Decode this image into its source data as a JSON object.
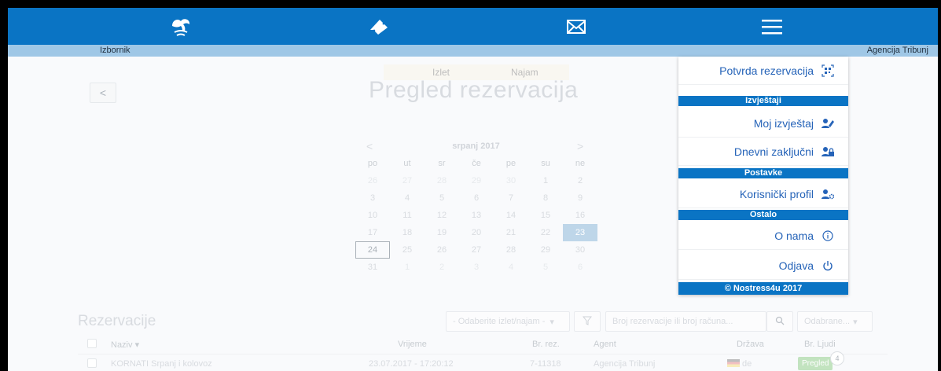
{
  "header": {
    "subbar_left": "Izbornik",
    "subbar_right": "Agencija Tribunj",
    "icons": [
      "island-icon",
      "ticket-icon",
      "mail-icon",
      "hamburger-menu-icon"
    ]
  },
  "main": {
    "tabs": [
      "Izlet",
      "Najam"
    ],
    "title": "Pregled rezervacija",
    "back_glyph": "<"
  },
  "calendar": {
    "month": "srpanj 2017",
    "prev": "<",
    "next": ">",
    "weekdays": [
      "po",
      "ut",
      "sr",
      "če",
      "pe",
      "su",
      "ne"
    ],
    "weeks": [
      [
        "26",
        "27",
        "28",
        "29",
        "30",
        "1",
        "2"
      ],
      [
        "3",
        "4",
        "5",
        "6",
        "7",
        "8",
        "9"
      ],
      [
        "10",
        "11",
        "12",
        "13",
        "14",
        "15",
        "16"
      ],
      [
        "17",
        "18",
        "19",
        "20",
        "21",
        "22",
        "23"
      ],
      [
        "24",
        "25",
        "26",
        "27",
        "28",
        "29",
        "30"
      ],
      [
        "31",
        "1",
        "2",
        "3",
        "4",
        "5",
        "6"
      ]
    ],
    "selected_day": "23",
    "today_day": "24"
  },
  "reservations": {
    "title": "Rezervacije",
    "filter_placeholder": "- Odaberite izlet/najam -",
    "search_placeholder": "Broj rezervacije ili broj računa...",
    "selected_label": "Odabrane...",
    "columns": [
      "Naziv",
      "Vrijeme",
      "Br. rez.",
      "Agent",
      "Država",
      "Br. Ljudi"
    ],
    "rows": [
      {
        "naziv": "KORNATI Srpanj i kolovoz",
        "vrijeme": "23.07.2017 - 17:20:12",
        "br_rez": "7-11318",
        "agent": "Agencija Tribunj",
        "drzava": "de",
        "action": "Pregled",
        "ljudi": "4"
      }
    ]
  },
  "menu": {
    "items": [
      {
        "label": "Potvrda rezervacija",
        "icon": "qr-code-icon"
      },
      {
        "section": "Izvještaji"
      },
      {
        "label": "Moj izvještaj",
        "icon": "user-report-icon"
      },
      {
        "label": "Dnevni zaključni",
        "icon": "user-lock-icon"
      },
      {
        "section": "Postavke"
      },
      {
        "label": "Korisnički profil",
        "icon": "user-settings-icon"
      },
      {
        "section": "Ostalo"
      },
      {
        "label": "O nama",
        "icon": "info-icon"
      },
      {
        "label": "Odjava",
        "icon": "power-icon"
      }
    ],
    "footer": "© Nostress4u 2017"
  },
  "colors": {
    "brand_blue": "#0a74c4",
    "subbar": "#9fc7e6",
    "menu_text": "#2563b8",
    "selected_day": "#9cc1dd"
  }
}
